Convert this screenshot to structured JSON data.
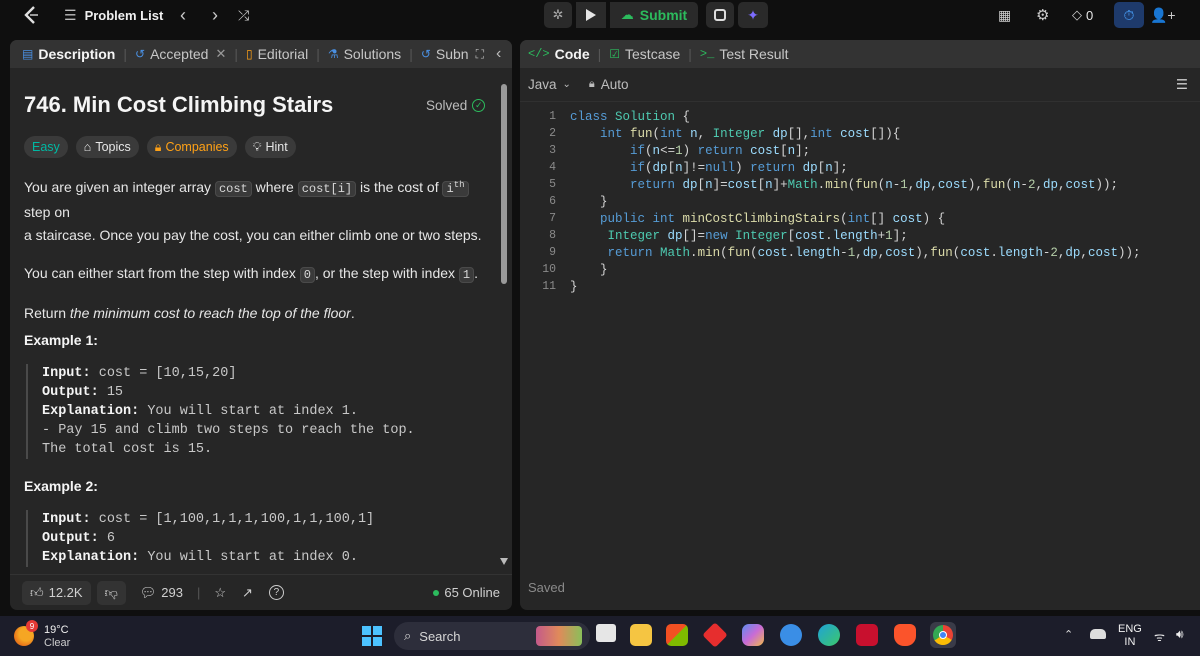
{
  "topbar": {
    "problem_list": "Problem List",
    "submit": "Submit",
    "streak": "0"
  },
  "left_tabs": {
    "description": "Description",
    "accepted": "Accepted",
    "editorial": "Editorial",
    "solutions": "Solutions",
    "submissions": "Subn"
  },
  "problem": {
    "title": "746. Min Cost Climbing Stairs",
    "status": "Solved",
    "difficulty": "Easy",
    "topics": "Topics",
    "companies": "Companies",
    "hint": "Hint",
    "p1_a": "You are given an integer array",
    "p1_code1": "cost",
    "p1_b": "where",
    "p1_code2": "cost[i]",
    "p1_c": "is the cost of",
    "p1_code3": "i",
    "p1_sup": "th",
    "p1_d": "step on",
    "p1_e": "a staircase. Once you pay the cost, you can either climb one or two steps.",
    "p2_a": "You can either start from the step with index",
    "p2_code1": "0",
    "p2_b": ", or the step with index",
    "p2_code2": "1",
    "p2_c": ".",
    "p3_a": "Return",
    "p3_em": "the minimum cost to reach the top of the floor",
    "p3_b": ".",
    "ex1_title": "Example 1:",
    "ex1_input_label": "Input:",
    "ex1_input": "cost = [10,15,20]",
    "ex1_output_label": "Output:",
    "ex1_output": "15",
    "ex1_expl_label": "Explanation:",
    "ex1_expl": "You will start at index 1.",
    "ex1_expl2": "- Pay 15 and climb two steps to reach the top.",
    "ex1_expl3": "The total cost is 15.",
    "ex2_title": "Example 2:",
    "ex2_input_label": "Input:",
    "ex2_input": "cost = [1,100,1,1,1,100,1,1,100,1]",
    "ex2_output_label": "Output:",
    "ex2_output": "6",
    "ex2_expl_label": "Explanation:",
    "ex2_expl": "You will start at index 0."
  },
  "left_footer": {
    "likes": "12.2K",
    "comments": "293",
    "online": "65 Online"
  },
  "code_tabs": {
    "code": "Code",
    "testcase": "Testcase",
    "result": "Test Result"
  },
  "editor": {
    "language": "Java",
    "mode": "Auto",
    "status": "Saved",
    "line_numbers": [
      "1",
      "2",
      "3",
      "4",
      "5",
      "6",
      "7",
      "8",
      "9",
      "10",
      "11"
    ]
  },
  "taskbar": {
    "weather_temp": "19°C",
    "weather_desc": "Clear",
    "weather_badge": "9",
    "search": "Search",
    "lang1": "ENG",
    "lang2": "IN"
  },
  "colors": {
    "accent_green": "#2cbb5d",
    "easy": "#00b8a3",
    "companies": "#ffa116"
  }
}
